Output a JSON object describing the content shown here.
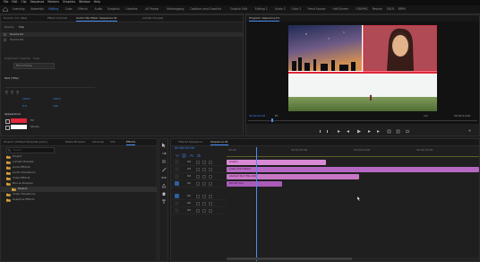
{
  "menu": [
    "File",
    "Edit",
    "Clip",
    "Sequence",
    "Markers",
    "Graphics",
    "Window",
    "Help"
  ],
  "workspaces": [
    {
      "label": "Learning"
    },
    {
      "label": "Assembly"
    },
    {
      "label": "Editing",
      "active": true
    },
    {
      "label": "Color"
    },
    {
      "label": "Effects"
    },
    {
      "label": "Audio"
    },
    {
      "label": "Graphics"
    },
    {
      "label": "Libraries"
    },
    {
      "label": "All Panels"
    },
    {
      "label": "Metalogging"
    },
    {
      "label": "Captions and Graphics"
    },
    {
      "label": "Graphic Edit"
    },
    {
      "label": "Editing 2"
    },
    {
      "label": "Audio 2"
    },
    {
      "label": "Color 2"
    },
    {
      "label": "Fresh Source"
    },
    {
      "label": "Half Screen"
    },
    {
      "label": "GRAPHIC"
    },
    {
      "label": "Review"
    },
    {
      "label": "DSLR"
    },
    {
      "label": "BRYN"
    }
  ],
  "effect_controls": {
    "tabs": [
      "Source: (no clips)",
      "Effect Controls",
      "Audio Clip Mixer: Sequence 01",
      "Lumetri Scopes"
    ],
    "subtabs": [
      "Source",
      "Clip"
    ],
    "rows": [
      "Source 01",
      "Source 02"
    ],
    "section_label": "Alignment: Opacity · Snap",
    "section_value": "Fit to Frame",
    "text_header": "Text (Title)",
    "fields": [
      "100.0",
      "100.0",
      "0.0",
      "100"
    ],
    "appearance_label": "Appearance",
    "fill_label": "Fill",
    "stroke_label": "Stroke",
    "colors": {
      "fill": "#e0273b",
      "stroke": "#ffffff"
    }
  },
  "program": {
    "tab": "Program: Sequence 01",
    "timecode_left": "00:00:01:00",
    "fit_label": "Fit",
    "timecode_right": "00:00:10:00",
    "page": "1/2"
  },
  "project": {
    "tabs": [
      "Project: Untitled Template.prproj",
      "Media Browser",
      "Libraries",
      "Info",
      "Effects"
    ],
    "search_placeholder": "Search",
    "items": [
      {
        "label": "Project",
        "type": "folder"
      },
      {
        "label": "Lumetri Presets",
        "type": "folder"
      },
      {
        "label": "Audio Effects",
        "type": "folder"
      },
      {
        "label": "Audio Transitions",
        "type": "folder"
      },
      {
        "label": "Video Effects",
        "type": "folder"
      },
      {
        "label": "Blur & Sharpen",
        "type": "folder"
      },
      {
        "label": "Distort",
        "type": "folder",
        "selected": true
      },
      {
        "label": "Video Transitions",
        "type": "folder"
      },
      {
        "label": "Graphics Effects",
        "type": "folder"
      }
    ]
  },
  "timeline": {
    "tabs": [
      "Title 01 Sequence",
      "Sequence 01"
    ],
    "timecode": "00:00:01:00",
    "ruler": [
      "00:00",
      "00:00:05:00",
      "00:00:10:00",
      "00:00:15:00"
    ],
    "video_tracks": [
      "V4",
      "V3",
      "V2",
      "V1"
    ],
    "audio_tracks": [
      "A1",
      "A2",
      "A3"
    ],
    "clips": [
      {
        "label": "Graphic",
        "color": "#d98ad4",
        "start": 0.0,
        "end": 7.5
      },
      {
        "label": "Lower Third (Bold)",
        "color": "#b568c1",
        "start": 0.0,
        "end": 19.0
      },
      {
        "label": "Abstract Tech Title 1920",
        "color": "#c977c5",
        "start": 0.0,
        "end": 10.0
      },
      {
        "label": "Smooth Pics",
        "color": "#a95bb8",
        "start": 0.0,
        "end": 4.2
      }
    ],
    "playhead": 2.25,
    "playhead_color": "#4a8cf7",
    "clip_track_seconds_visible": 19.0
  }
}
